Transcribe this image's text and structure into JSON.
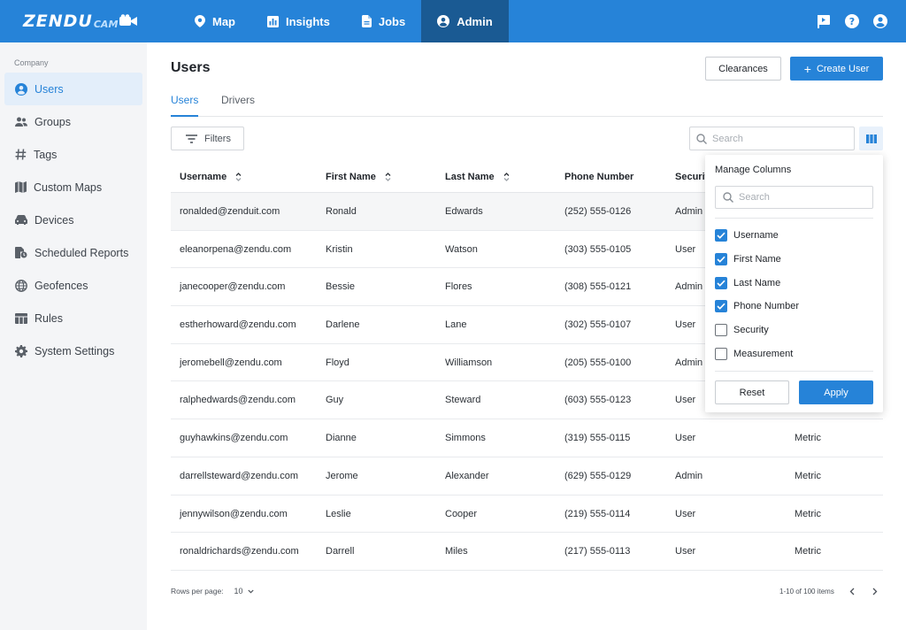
{
  "brand": {
    "main": "ZENDU",
    "sub": "CAM"
  },
  "nav": {
    "items": [
      "Map",
      "Insights",
      "Jobs",
      "Admin"
    ],
    "active": "Admin"
  },
  "sidebar": {
    "caption": "Company",
    "items": [
      "Users",
      "Groups",
      "Tags",
      "Custom Maps",
      "Devices",
      "Scheduled Reports",
      "Geofences",
      "Rules",
      "System Settings"
    ],
    "active": "Users"
  },
  "page": {
    "title": "Users",
    "clearances_label": "Clearances",
    "create_label": "Create User",
    "tabs": [
      "Users",
      "Drivers"
    ],
    "filters_label": "Filters",
    "search_placeholder": "Search"
  },
  "table": {
    "columns": [
      "Username",
      "First Name",
      "Last Name",
      "Phone Number",
      "Securit"
    ],
    "rows": [
      [
        "ronalded@zenduit.com",
        "Ronald",
        "Edwards",
        "(252) 555-0126",
        "Admin",
        ""
      ],
      [
        "eleanorpena@zendu.com",
        "Kristin",
        "Watson",
        "(303) 555-0105",
        "User",
        ""
      ],
      [
        "janecooper@zendu.com",
        "Bessie",
        "Flores",
        "(308) 555-0121",
        "Admin",
        ""
      ],
      [
        "estherhoward@zendu.com",
        "Darlene",
        "Lane",
        "(302) 555-0107",
        "User",
        ""
      ],
      [
        "jeromebell@zendu.com",
        "Floyd",
        "Williamson",
        "(205) 555-0100",
        "Admin",
        ""
      ],
      [
        "ralphedwards@zendu.com",
        "Guy",
        "Steward",
        "(603) 555-0123",
        "User",
        ""
      ],
      [
        "guyhawkins@zendu.com",
        "Dianne",
        "Simmons",
        "(319) 555-0115",
        "User",
        "Metric"
      ],
      [
        "darrellsteward@zendu.com",
        "Jerome",
        "Alexander",
        "(629) 555-0129",
        "Admin",
        "Metric"
      ],
      [
        "jennywilson@zendu.com",
        "Leslie",
        "Cooper",
        "(219) 555-0114",
        "User",
        "Metric"
      ],
      [
        "ronaldrichards@zendu.com",
        "Darrell",
        "Miles",
        "(217) 555-0113",
        "User",
        "Metric"
      ]
    ]
  },
  "pagination": {
    "rows_per_page_label": "Rows per page:",
    "rows_per_page": "10",
    "range": "1-10 of 100 items"
  },
  "manage_columns": {
    "title": "Manage Columns",
    "search_placeholder": "Search",
    "options": [
      {
        "label": "Username",
        "checked": true
      },
      {
        "label": "First Name",
        "checked": true
      },
      {
        "label": "Last Name",
        "checked": true
      },
      {
        "label": "Phone Number",
        "checked": true
      },
      {
        "label": "Security",
        "checked": false
      },
      {
        "label": "Measurement",
        "checked": false
      }
    ],
    "reset_label": "Reset",
    "apply_label": "Apply"
  },
  "colors": {
    "primary": "#2683d8",
    "nav_active": "#1a5a93",
    "sidebar_bg": "#f4f5f7",
    "sidebar_active_bg": "#e3eefa"
  }
}
